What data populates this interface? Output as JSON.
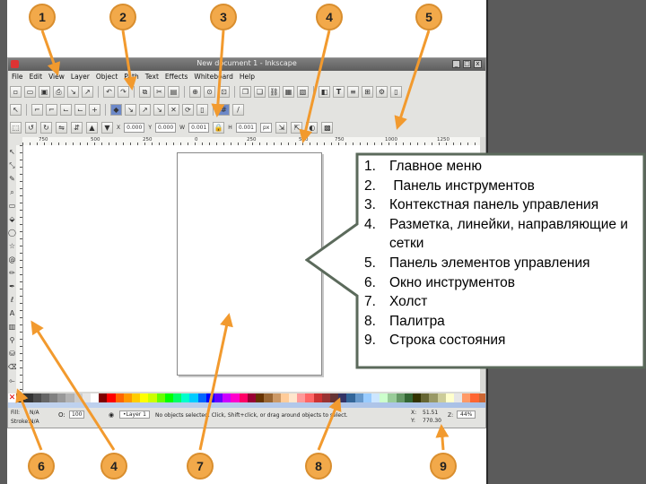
{
  "window": {
    "title": "New document 1 - Inkscape",
    "controls": [
      "_",
      "□",
      "x"
    ]
  },
  "menu": [
    "File",
    "Edit",
    "View",
    "Layer",
    "Object",
    "Path",
    "Text",
    "Effects",
    "Whiteboard",
    "Help"
  ],
  "commands_bar": {
    "icons": [
      "new-icon",
      "open-icon",
      "save-icon",
      "print-icon",
      "import-icon",
      "export-icon",
      "undo-icon",
      "redo-icon",
      "copy-icon",
      "cut-icon",
      "paste-icon",
      "zoom-selection-icon",
      "zoom-drawing-icon",
      "zoom-page-icon",
      "duplicate-icon",
      "clone-icon",
      "unlink-icon",
      "group-icon",
      "ungroup-icon",
      "fill-stroke-icon",
      "text-font-icon",
      "xml-editor-icon",
      "align-icon",
      "preferences-icon",
      "document-properties-icon"
    ]
  },
  "snap_bar": {
    "icons": [
      "snap-toggle-icon",
      "snap-bbox-icon",
      "snap-bbox-edge-icon",
      "snap-bbox-corner-icon",
      "snap-midpoint-icon",
      "snap-center-icon",
      "snap-nodes-icon",
      "snap-path-icon",
      "snap-cusp-icon",
      "snap-smooth-icon",
      "snap-intersection-icon",
      "snap-rotation-icon",
      "snap-page-icon",
      "snap-grid-icon",
      "snap-guide-icon"
    ]
  },
  "tool_controls": {
    "x_label": "X",
    "x_value": "0.000",
    "y_label": "Y",
    "y_value": "0.000",
    "w_label": "W",
    "w_value": "0.001",
    "h_label": "H",
    "h_value": "0.001",
    "units": "px"
  },
  "ruler": {
    "labels": [
      "750",
      "500",
      "250",
      "0",
      "250",
      "500",
      "750",
      "1000",
      "1250"
    ]
  },
  "tools": [
    "selector-tool-icon",
    "node-tool-icon",
    "tweak-tool-icon",
    "zoom-tool-icon",
    "rect-tool-icon",
    "3dbox-tool-icon",
    "ellipse-tool-icon",
    "star-tool-icon",
    "spiral-tool-icon",
    "pencil-tool-icon",
    "pen-tool-icon",
    "calligraphy-tool-icon",
    "text-tool-icon",
    "gradient-tool-icon",
    "dropper-tool-icon",
    "paint-bucket-tool-icon",
    "eraser-tool-icon",
    "connector-tool-icon"
  ],
  "palette": {
    "colors": [
      "#000000",
      "#1a1a1a",
      "#333333",
      "#4d4d4d",
      "#666666",
      "#808080",
      "#999999",
      "#b3b3b3",
      "#cccccc",
      "#e6e6e6",
      "#ffffff",
      "#800000",
      "#ff0000",
      "#ff6600",
      "#ff9900",
      "#ffcc00",
      "#ffff00",
      "#ccff00",
      "#66ff00",
      "#00ff00",
      "#00ff66",
      "#00ffcc",
      "#00ccff",
      "#0066ff",
      "#0000ff",
      "#6600ff",
      "#cc00ff",
      "#ff00cc",
      "#ff0066",
      "#990033",
      "#663300",
      "#996633",
      "#cc9966",
      "#ffcc99",
      "#ffe6cc",
      "#ff9999",
      "#ff6666",
      "#cc3333",
      "#993333",
      "#663333",
      "#333366",
      "#336699",
      "#6699cc",
      "#99ccff",
      "#cce6ff",
      "#ccffcc",
      "#99cc99",
      "#669966",
      "#336633",
      "#333300",
      "#666633",
      "#999966",
      "#cccc99",
      "#ffffcc",
      "#e6e6e6",
      "#ff9966",
      "#ff6633",
      "#cc6633"
    ]
  },
  "statusbar": {
    "fill_label": "Fill:",
    "fill_value": "N/A",
    "stroke_label": "Stroke:",
    "stroke_value": "N/A",
    "opacity_value": "100",
    "layer_value": "•Layer 1",
    "message": "No objects selected. Click, Shift+click, or drag around objects to select.",
    "x_label": "X:",
    "x_value": "51.51",
    "y_label": "Y:",
    "y_value": "770.30",
    "zoom_label": "Z:",
    "zoom_value": "44%"
  },
  "legend": {
    "items": [
      {
        "num": "1.",
        "text": "Главное меню"
      },
      {
        "num": "2.",
        "text": " Панель инструментов"
      },
      {
        "num": "3.",
        "text": "Контекстная панель управления"
      },
      {
        "num": "4.",
        "text": "Разметка, линейки, направляющие и сетки"
      },
      {
        "num": "5.",
        "text": "Панель элементов управления"
      },
      {
        "num": "6.",
        "text": "Окно инструментов"
      },
      {
        "num": "7.",
        "text": "Холст"
      },
      {
        "num": "8.",
        "text": "Палитра"
      },
      {
        "num": "9.",
        "text": "Строка состояния"
      }
    ]
  },
  "markers": [
    "1",
    "2",
    "3",
    "4",
    "5",
    "6",
    "4",
    "7",
    "8",
    "9"
  ],
  "accent": {
    "marker_fill": "#f2a94a",
    "marker_border": "#d98e2e",
    "frame": "#5b5b5b"
  }
}
